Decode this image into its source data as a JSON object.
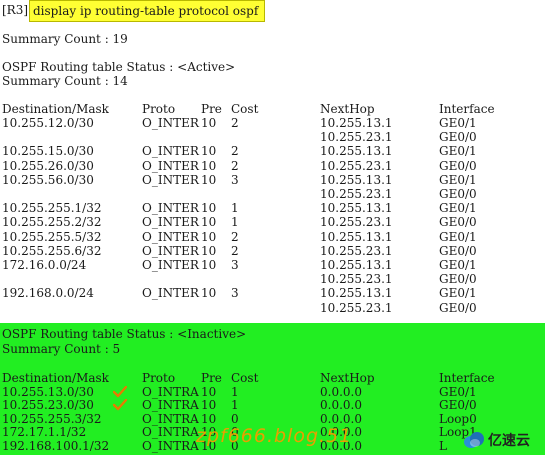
{
  "command": {
    "prompt": "[R3]",
    "text": "display ip routing-table protocol ospf"
  },
  "summary_total": "Summary Count : 19",
  "active_section": {
    "status": "OSPF Routing table Status : <Active>",
    "count": "Summary Count : 14",
    "headers": [
      "Destination/Mask",
      "Proto",
      "Pre",
      "Cost",
      "NextHop",
      "Interface"
    ],
    "rows": [
      [
        "10.255.12.0/30",
        "O_INTER",
        "10",
        "2",
        "10.255.13.1",
        "GE0/1"
      ],
      [
        "",
        "",
        "",
        "",
        "10.255.23.1",
        "GE0/0"
      ],
      [
        "10.255.15.0/30",
        "O_INTER",
        "10",
        "2",
        "10.255.13.1",
        "GE0/1"
      ],
      [
        "10.255.26.0/30",
        "O_INTER",
        "10",
        "2",
        "10.255.23.1",
        "GE0/0"
      ],
      [
        "10.255.56.0/30",
        "O_INTER",
        "10",
        "3",
        "10.255.13.1",
        "GE0/1"
      ],
      [
        "",
        "",
        "",
        "",
        "10.255.23.1",
        "GE0/0"
      ],
      [
        "10.255.255.1/32",
        "O_INTER",
        "10",
        "1",
        "10.255.13.1",
        "GE0/1"
      ],
      [
        "10.255.255.2/32",
        "O_INTER",
        "10",
        "1",
        "10.255.23.1",
        "GE0/0"
      ],
      [
        "10.255.255.5/32",
        "O_INTER",
        "10",
        "2",
        "10.255.13.1",
        "GE0/1"
      ],
      [
        "10.255.255.6/32",
        "O_INTER",
        "10",
        "2",
        "10.255.23.1",
        "GE0/0"
      ],
      [
        "172.16.0.0/24",
        "O_INTER",
        "10",
        "3",
        "10.255.13.1",
        "GE0/1"
      ],
      [
        "",
        "",
        "",
        "",
        "10.255.23.1",
        "GE0/0"
      ],
      [
        "192.168.0.0/24",
        "O_INTER",
        "10",
        "3",
        "10.255.13.1",
        "GE0/1"
      ],
      [
        "",
        "",
        "",
        "",
        "10.255.23.1",
        "GE0/0"
      ]
    ]
  },
  "inactive_section": {
    "status": "OSPF Routing table Status : <Inactive>",
    "count": "Summary Count : 5",
    "headers": [
      "Destination/Mask",
      "Proto",
      "Pre",
      "Cost",
      "NextHop",
      "Interface"
    ],
    "rows": [
      [
        "10.255.13.0/30",
        "O_INTRA",
        "10",
        "1",
        "0.0.0.0",
        "GE0/1"
      ],
      [
        "10.255.23.0/30",
        "O_INTRA",
        "10",
        "1",
        "0.0.0.0",
        "GE0/0"
      ],
      [
        "10.255.255.3/32",
        "O_INTRA",
        "10",
        "0",
        "0.0.0.0",
        "Loop0"
      ],
      [
        "172.17.1.1/32",
        "O_INTRA",
        "10",
        "0",
        "0.0.0.0",
        "Loop1"
      ],
      [
        "192.168.100.1/32",
        "O_INTRA",
        "10",
        "0",
        "0.0.0.0",
        "L"
      ]
    ]
  },
  "watermark": "zpf666.blog.51",
  "logo_text": "亿速云",
  "colors": {
    "command_highlight": "#ffff33",
    "inactive_background": "#22ee22",
    "checkmark": "#e87a00",
    "watermark": "#e8a000"
  }
}
